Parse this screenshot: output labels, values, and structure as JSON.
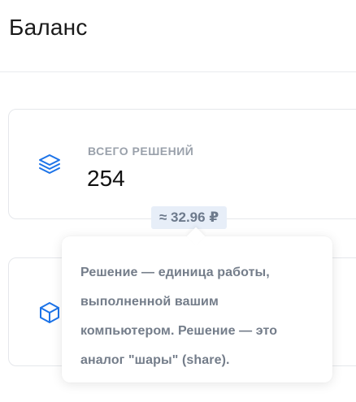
{
  "header": {
    "title": "Баланс"
  },
  "cards": [
    {
      "icon": "layers-icon",
      "label": "ВСЕГО РЕШЕНИЙ",
      "value": "254"
    },
    {
      "icon": "cube-icon"
    }
  ],
  "badge": {
    "text": "≈ 32.96 ₽"
  },
  "tooltip": {
    "lines": [
      "Решение — единица работы,",
      "выполненной вашим",
      "компьютером. Решение — это",
      "аналог \"шары\" (share)."
    ]
  },
  "colors": {
    "accent": "#1c73e8",
    "muted_text": "#9aa1ab",
    "badge_bg": "#e7eef8"
  }
}
